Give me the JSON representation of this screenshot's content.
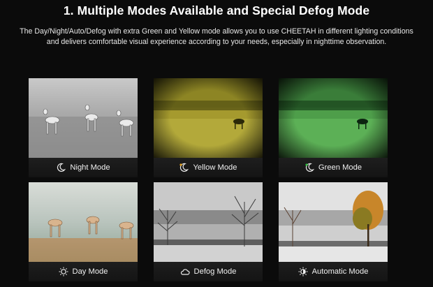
{
  "heading": "1. Multiple Modes Available and Special Defog Mode",
  "description": "The Day/Night/Auto/Defog with extra Green and Yellow mode allows you to use CHEETAH in different lighting conditions and delivers comfortable visual experience according to your needs, especially in nighttime observation.",
  "modes": [
    {
      "label": "Night Mode",
      "icon": "moon-icon"
    },
    {
      "label": "Yellow Mode",
      "icon": "moon-yellow-icon"
    },
    {
      "label": "Green Mode",
      "icon": "moon-green-icon"
    },
    {
      "label": "Day Mode",
      "icon": "sun-icon"
    },
    {
      "label": "Defog Mode",
      "icon": "cloud-icon"
    },
    {
      "label": "Automatic Mode",
      "icon": "auto-icon"
    }
  ],
  "colors": {
    "background": "#0b0b0b",
    "yellow_tint": "#b8a83a",
    "green_tint": "#4caa4c"
  }
}
